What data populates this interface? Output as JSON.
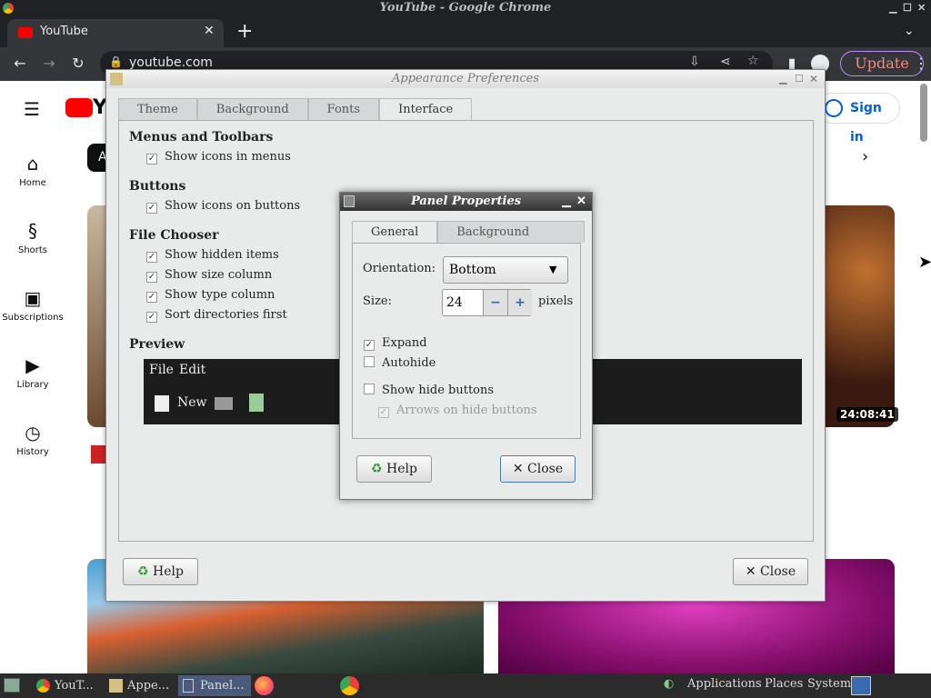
{
  "window_title": "YouTube - Google Chrome",
  "browser": {
    "tab_title": "YouTube",
    "url": "youtube.com",
    "update_label": "Update"
  },
  "youtube": {
    "sidebar": [
      {
        "label": "Home",
        "icon": "home-icon"
      },
      {
        "label": "Shorts",
        "icon": "shorts-icon"
      },
      {
        "label": "Subscriptions",
        "icon": "subscriptions-icon"
      },
      {
        "label": "Library",
        "icon": "library-icon"
      },
      {
        "label": "History",
        "icon": "history-icon"
      }
    ],
    "signin": "Sign in",
    "chip_partial": "A",
    "video_duration": "24:08:41"
  },
  "appearance": {
    "title": "Appearance Preferences",
    "tabs": [
      "Theme",
      "Background",
      "Fonts",
      "Interface"
    ],
    "active_tab": "Interface",
    "sections": {
      "menus": {
        "title": "Menus and Toolbars",
        "items": [
          "Show icons in menus"
        ]
      },
      "buttons": {
        "title": "Buttons",
        "items": [
          "Show icons on buttons"
        ]
      },
      "file_chooser": {
        "title": "File Chooser",
        "items": [
          "Show hidden items",
          "Show size column",
          "Show type column",
          "Sort directories first"
        ]
      },
      "preview": {
        "title": "Preview",
        "menu": [
          "File",
          "Edit"
        ],
        "tool_new": "New"
      }
    },
    "help": "Help",
    "close": "Close"
  },
  "panel_properties": {
    "title": "Panel Properties",
    "tabs": [
      "General",
      "Background"
    ],
    "orientation_label": "Orientation:",
    "orientation_value": "Bottom",
    "size_label": "Size:",
    "size_value": "24",
    "size_unit": "pixels",
    "expand": "Expand",
    "autohide": "Autohide",
    "show_hide_buttons": "Show hide buttons",
    "arrows_on_hide": "Arrows on hide buttons",
    "help": "Help",
    "close": "Close"
  },
  "taskbar": {
    "tasks": [
      "YouT...",
      "Appe...",
      "Panel..."
    ],
    "menus": [
      "Applications",
      "Places",
      "System"
    ]
  }
}
